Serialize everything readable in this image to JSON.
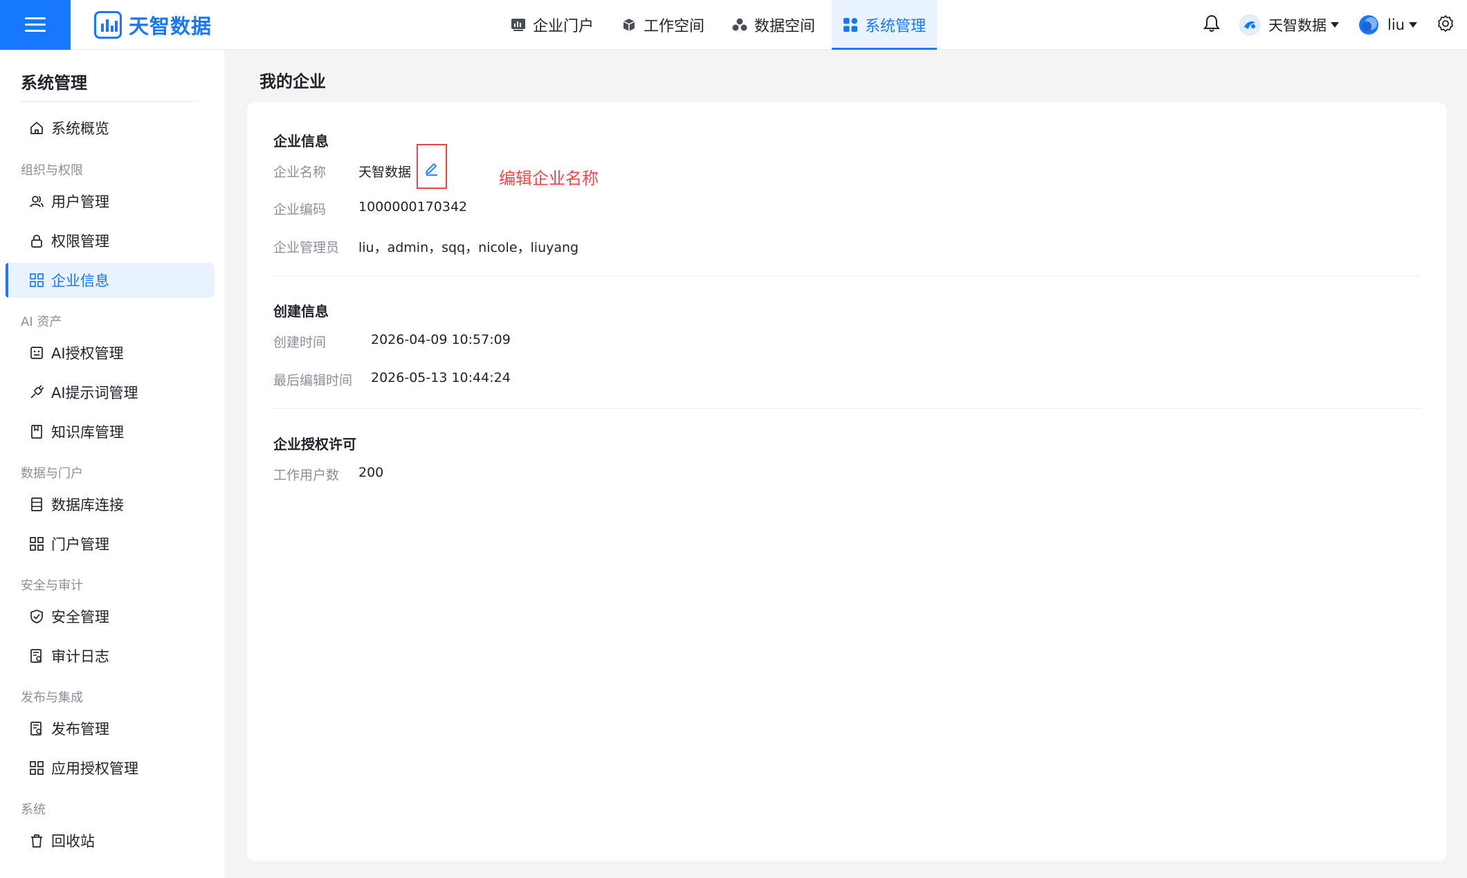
{
  "header": {
    "logo_text": "天智数据",
    "nav": [
      {
        "label": "企业门户",
        "icon": "portal-chart-icon"
      },
      {
        "label": "工作空间",
        "icon": "cube-icon"
      },
      {
        "label": "数据空间",
        "icon": "cubes-icon"
      },
      {
        "label": "系统管理",
        "icon": "grid-icon",
        "active": true
      }
    ],
    "org_name": "天智数据",
    "user_name": "liu",
    "accent_color": "#1677ff"
  },
  "sidebar": {
    "title": "系统管理",
    "overview": "系统概览",
    "groups": {
      "org": "组织与权限",
      "ai": "AI 资产",
      "data": "数据与门户",
      "security": "安全与审计",
      "publish": "发布与集成",
      "system": "系统"
    },
    "items": {
      "users": "用户管理",
      "permissions": "权限管理",
      "enterprise": "企业信息",
      "ai_auth": "AI授权管理",
      "ai_prompt": "AI提示词管理",
      "knowledge": "知识库管理",
      "db_conn": "数据库连接",
      "portal": "门户管理",
      "security": "安全管理",
      "audit": "审计日志",
      "publish": "发布管理",
      "app_auth": "应用授权管理",
      "recycle": "回收站"
    }
  },
  "main": {
    "page_title": "我的企业",
    "enterprise_info": {
      "title": "企业信息",
      "name_label": "企业名称",
      "name_value": "天智数据",
      "code_label": "企业编码",
      "code_value": "1000000170342",
      "admins_label": "企业管理员",
      "admins_value": "liu，admin，sqq，nicole，liuyang"
    },
    "create_info": {
      "title": "创建信息",
      "created_label": "创建时间",
      "created_value": "2026-04-09 10:57:09",
      "edited_label": "最后编辑时间",
      "edited_value": "2026-05-13 10:44:24"
    },
    "license": {
      "title": "企业授权许可",
      "users_label": "工作用户数",
      "users_value": "200"
    },
    "annotation": "编辑企业名称"
  }
}
